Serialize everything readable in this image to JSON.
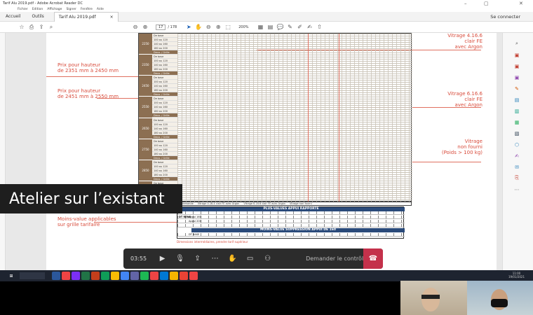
{
  "window": {
    "title": "Tarif Alu 2019.pdf - Adobe Acrobat Reader DC",
    "menu": [
      "Fichier",
      "Edition",
      "Affichage",
      "Signer",
      "Fenêtre",
      "Aide"
    ]
  },
  "tabs": {
    "home": "Accueil",
    "tools": "Outils",
    "document": "Tarif Alu 2019.pdf",
    "close": "×",
    "sign_in": "Se connecter"
  },
  "toolbar": {
    "page_current": "17",
    "page_total": "/ 178",
    "zoom": "200%"
  },
  "document": {
    "labels": {
      "price_2351": "Prix pour hauteur\nde 2351 mm à 2450 mm",
      "price_2451": "Prix pour hauteur\nde 2451 mm à 2550 mm",
      "glazing_1": "Vitrage 4.16.6\nclair FE\navec Argon",
      "glazing_2": "Vitrage 6.16.6\nclair FE\navec Argon",
      "glazing_3": "Vitrage\nnon fourni\n(Poids > 100 kg)",
      "minus_values": "Moins-value applicables\nsur grille tarifaire"
    },
    "table_row_labels": [
      "De base",
      "100 au 120",
      "140 au 160",
      "180 au 200",
      "Deco. / Grille"
    ],
    "height_codes": [
      "2250",
      "2350",
      "2450",
      "2550",
      "2650",
      "2750",
      "2850",
      "2950"
    ],
    "legend": {
      "item1": "Vitrage à la demande",
      "item2": "Vitrage 4.16.4 clair FE avec Argon",
      "item3": "Vitrage 6.16.6 clair FE avec Argon",
      "item4": "Vitrage non fourni"
    },
    "plus_values_title": "PLUS-VALUES APPUI RAPPORTE",
    "plus_values_rows": [
      "Appui 160",
      "Appui 200"
    ],
    "plus_values_label": "DT RENO",
    "minus_values_title": "MOINS-VALUE SUPPRESSION APPUI DE 160",
    "minus_values_label": "DT BASE",
    "note": "Dimensions intermédiaires, prendre tarif supérieur"
  },
  "caption": "Atelier sur l’existant",
  "meeting": {
    "timer": "03:55",
    "raise_hand_label": "Demander le contrôle"
  },
  "taskbar": {
    "time": "11:00",
    "date": "19/01/2021"
  },
  "colors": {
    "accent_red": "#d84b3b",
    "table_brown": "#8c6f52",
    "header_blue": "#2a4a7a",
    "hangup_red": "#c4314b"
  }
}
